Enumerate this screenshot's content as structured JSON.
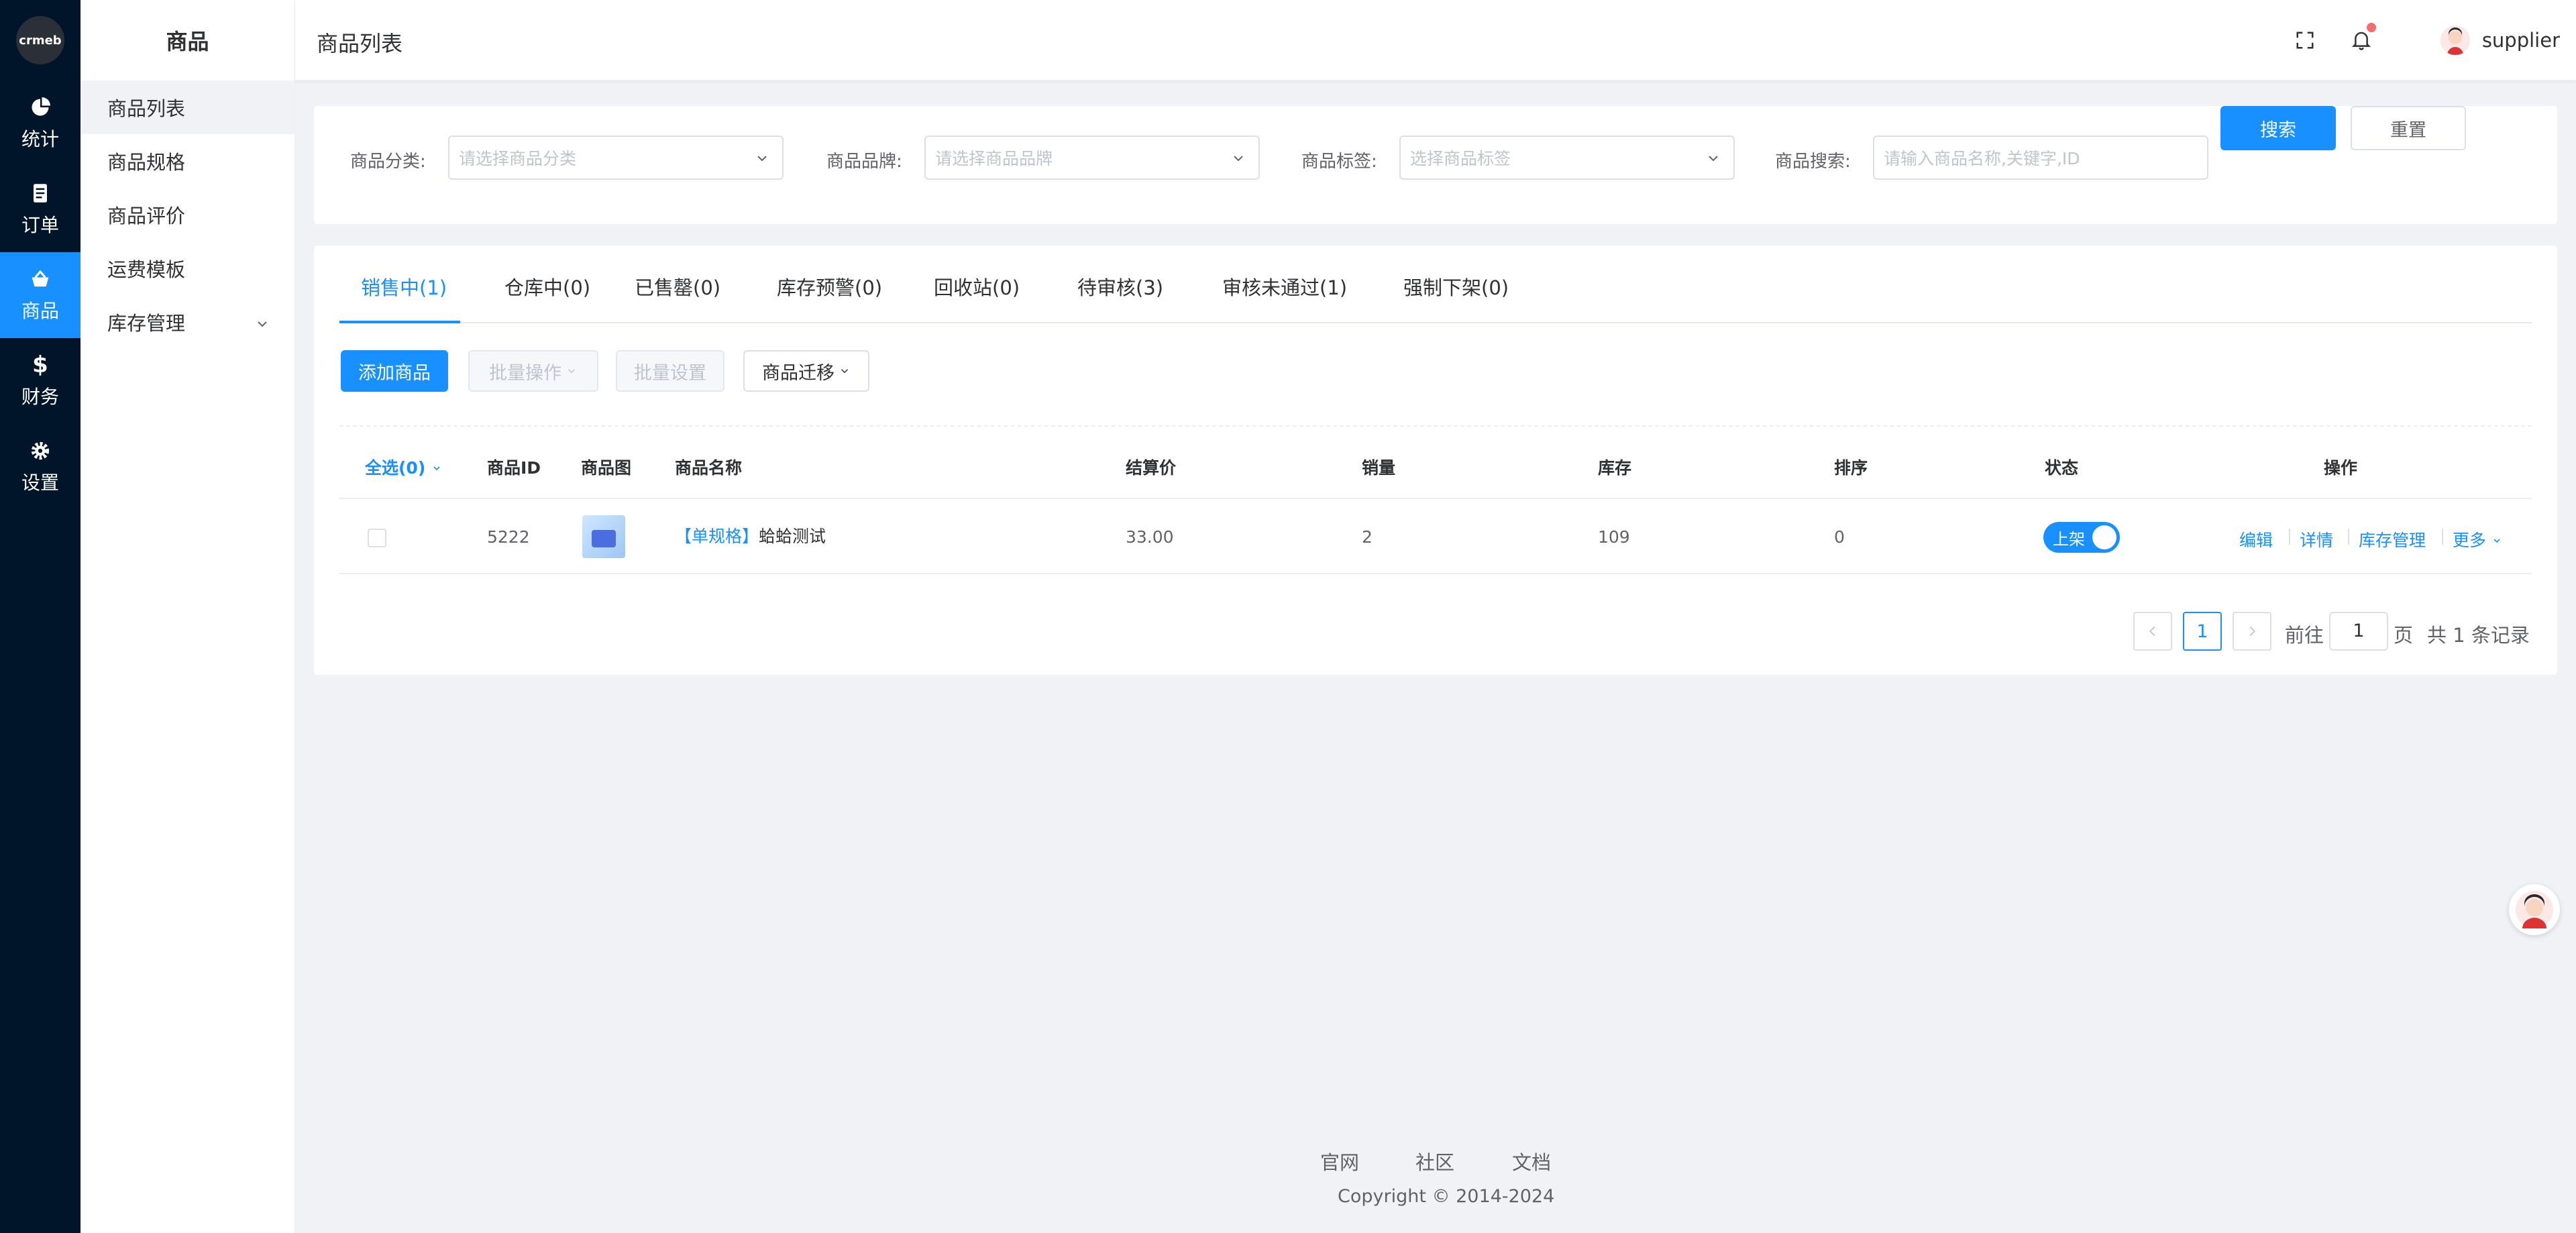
{
  "brand": {
    "logo_text": "crmeb"
  },
  "rail": [
    {
      "label": "统计",
      "icon": "pie-chart-icon"
    },
    {
      "label": "订单",
      "icon": "document-icon"
    },
    {
      "label": "商品",
      "icon": "basket-icon",
      "active": true
    },
    {
      "label": "财务",
      "icon": "dollar-icon"
    },
    {
      "label": "设置",
      "icon": "gear-icon"
    }
  ],
  "submenu": {
    "title": "商品",
    "items": [
      "商品列表",
      "商品规格",
      "商品评价",
      "运费模板",
      "库存管理"
    ]
  },
  "header": {
    "title": "商品列表",
    "user": "supplier"
  },
  "filters": {
    "category_label": "商品分类:",
    "category_placeholder": "请选择商品分类",
    "brand_label": "商品品牌:",
    "brand_placeholder": "请选择商品品牌",
    "tag_label": "商品标签:",
    "tag_placeholder": "选择商品标签",
    "search_label": "商品搜索:",
    "search_placeholder": "请输入商品名称,关键字,ID",
    "search_button": "搜索",
    "reset_button": "重置"
  },
  "tabs": [
    "销售中(1)",
    "仓库中(0)",
    "已售罄(0)",
    "库存预警(0)",
    "回收站(0)",
    "待审核(3)",
    "审核未通过(1)",
    "强制下架(0)"
  ],
  "toolbar": {
    "add": "添加商品",
    "batch_ops": "批量操作",
    "batch_settings": "批量设置",
    "migrate": "商品迁移"
  },
  "table": {
    "headers": {
      "select_all": "全选(0)",
      "id": "商品ID",
      "image": "商品图",
      "name": "商品名称",
      "price": "结算价",
      "sales": "销量",
      "stock": "库存",
      "sort": "排序",
      "status": "状态",
      "actions": "操作"
    },
    "rows": [
      {
        "id": "5222",
        "spec_tag": "【单规格】",
        "name": "蛤蛤测试",
        "price": "33.00",
        "sales": "2",
        "stock": "109",
        "sort": "0",
        "status": "上架",
        "actions": [
          "编辑",
          "详情",
          "库存管理",
          "更多"
        ]
      }
    ]
  },
  "pagination": {
    "current": "1",
    "goto_label": "前往",
    "goto_value": "1",
    "page_unit": "页",
    "total": "共 1 条记录"
  },
  "footer": {
    "links": [
      "官网",
      "社区",
      "文档"
    ],
    "copyright": "Copyright © 2014-2024"
  },
  "colors": {
    "accent": "#1890ff",
    "rail": "#001529",
    "page_bg": "#f0f2f5"
  }
}
